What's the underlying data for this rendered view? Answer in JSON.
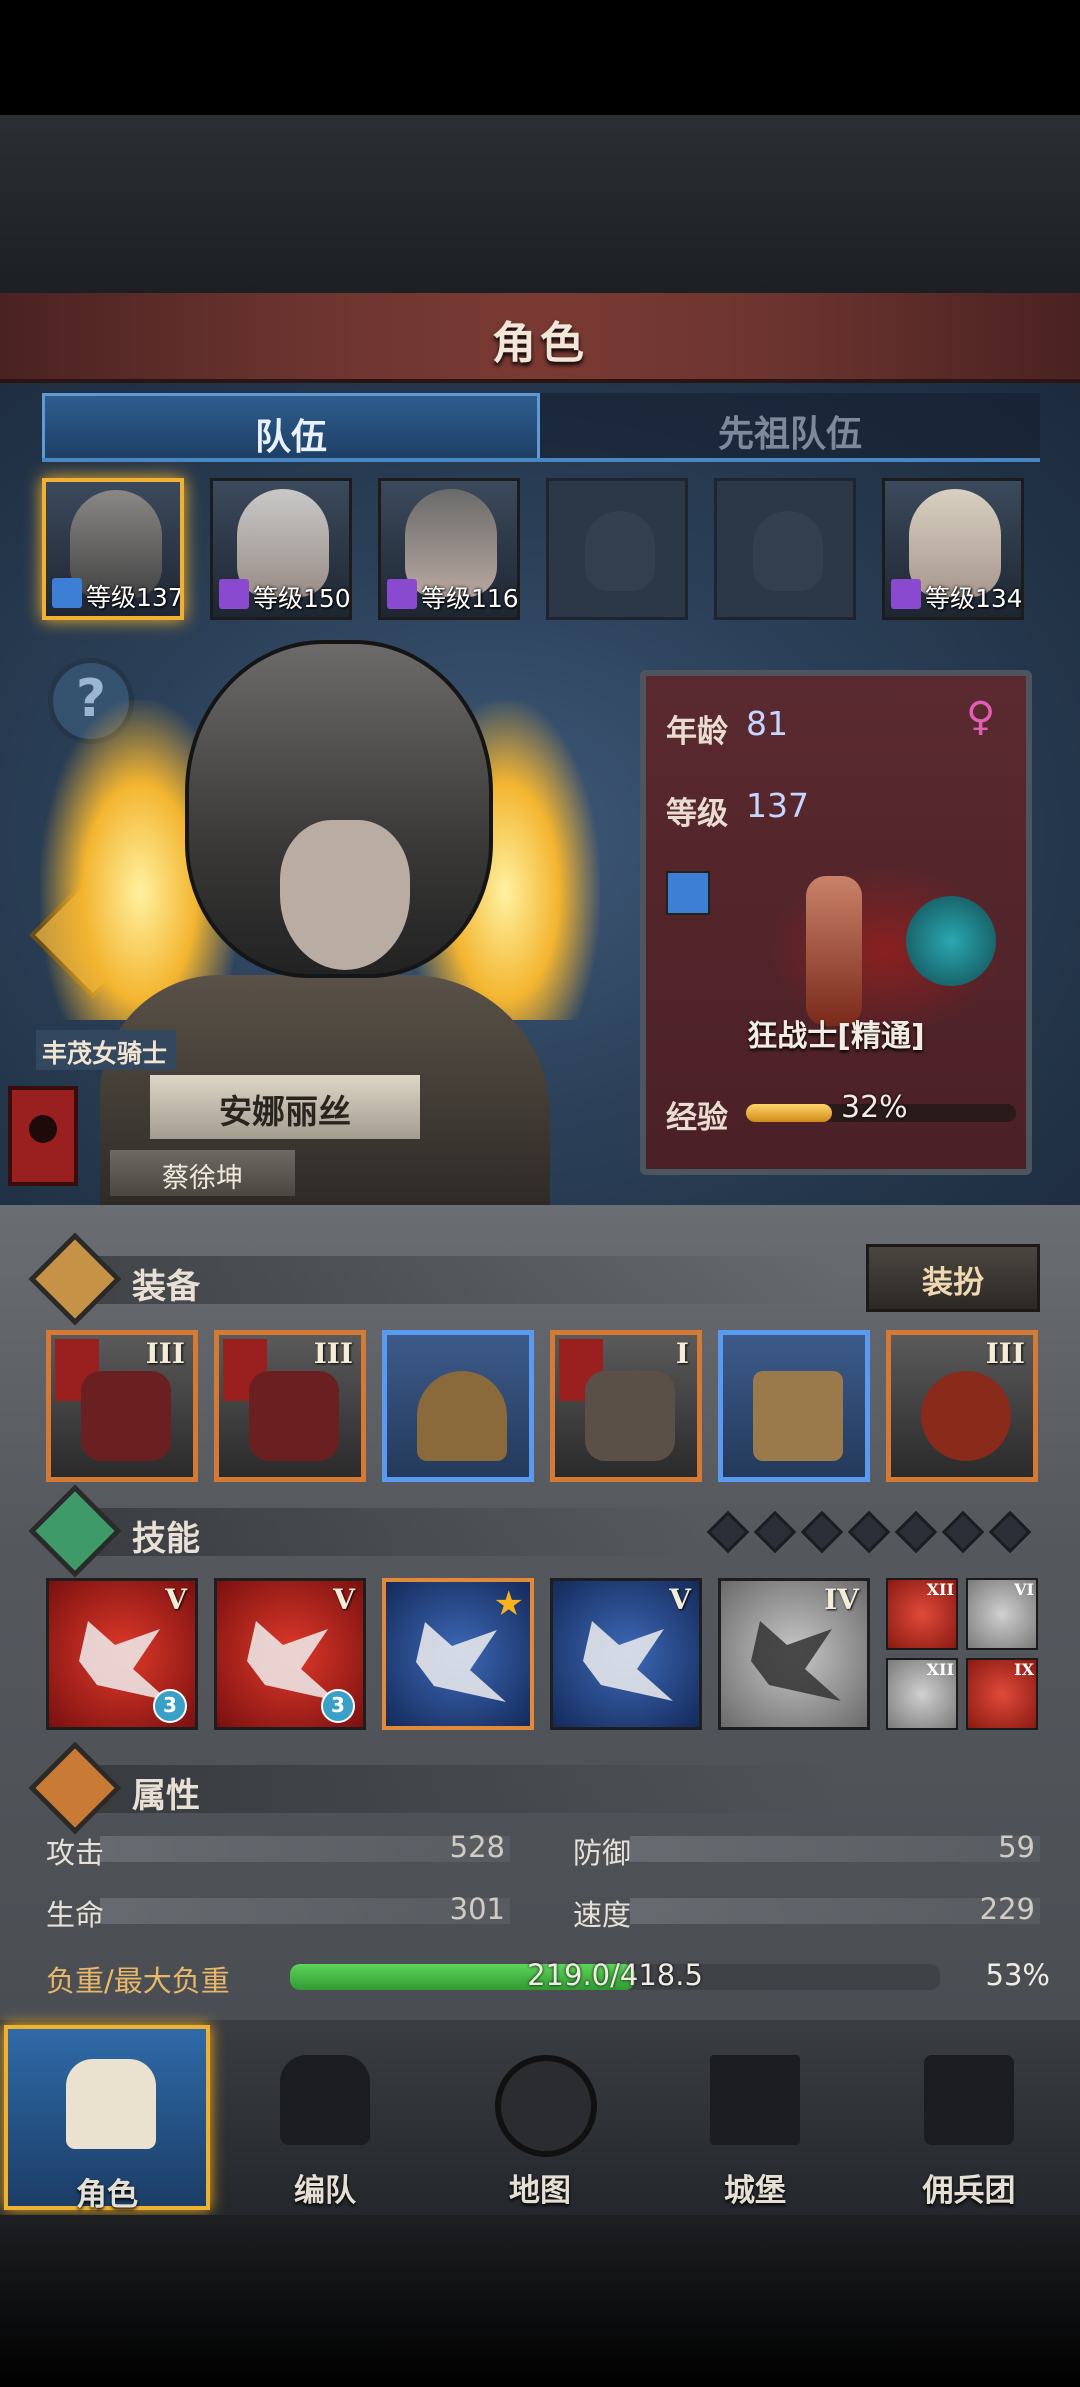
{
  "header": {
    "title": "角色"
  },
  "tabs": [
    {
      "label": "队伍"
    },
    {
      "label": "先祖队伍"
    }
  ],
  "team": [
    {
      "level": "等级137",
      "selected": true
    },
    {
      "level": "等级150"
    },
    {
      "level": "等级116"
    },
    {
      "level": "",
      "empty": true
    },
    {
      "level": "",
      "empty": true
    },
    {
      "level": "等级134"
    }
  ],
  "help": {
    "label": "?"
  },
  "hero": {
    "title": "丰茂女骑士",
    "name": "安娜丽丝",
    "player": "蔡徐坤"
  },
  "info": {
    "age_label": "年龄",
    "age_value": "81",
    "gender_icon": "female-icon",
    "level_label": "等级",
    "level_value": "137",
    "class_name": "狂战士[精通]",
    "exp_label": "经验",
    "exp_value": "32%",
    "exp_fraction": 0.32
  },
  "equipment": {
    "title": "装备",
    "dress_button": "装扮",
    "items": [
      {
        "tier": "III",
        "style": "orange",
        "flag": true
      },
      {
        "tier": "III",
        "style": "orange",
        "flag": true
      },
      {
        "tier": "",
        "style": "blue"
      },
      {
        "tier": "I",
        "style": "orange",
        "flag": true
      },
      {
        "tier": "",
        "style": "blue"
      },
      {
        "tier": "III",
        "style": "orange"
      }
    ]
  },
  "skills": {
    "title": "技能",
    "slot_count": 7,
    "items": [
      {
        "tier": "V",
        "badge": "3"
      },
      {
        "tier": "V",
        "badge": "3"
      },
      {
        "tier": "★"
      },
      {
        "tier": "V"
      },
      {
        "tier": "IV"
      }
    ],
    "passives": [
      {
        "tier": "XII"
      },
      {
        "tier": "VI"
      },
      {
        "tier": "XII"
      },
      {
        "tier": "IX"
      }
    ]
  },
  "attributes": {
    "title": "属性",
    "attack_label": "攻击",
    "attack_value": "528",
    "defense_label": "防御",
    "defense_value": "59",
    "hp_label": "生命",
    "hp_value": "301",
    "speed_label": "速度",
    "speed_value": "229",
    "load_label": "负重/最大负重",
    "load_value": "219.0/418.5",
    "load_percent": "53%",
    "load_fraction": 0.53
  },
  "nav": [
    {
      "label": "角色"
    },
    {
      "label": "编队"
    },
    {
      "label": "地图"
    },
    {
      "label": "城堡"
    },
    {
      "label": "佣兵团"
    }
  ],
  "colors": {
    "accent_gold": "#f0b030",
    "tab_blue": "#5f9ad4",
    "panel_red": "#5a2a30",
    "load_green": "#2f9a32"
  }
}
